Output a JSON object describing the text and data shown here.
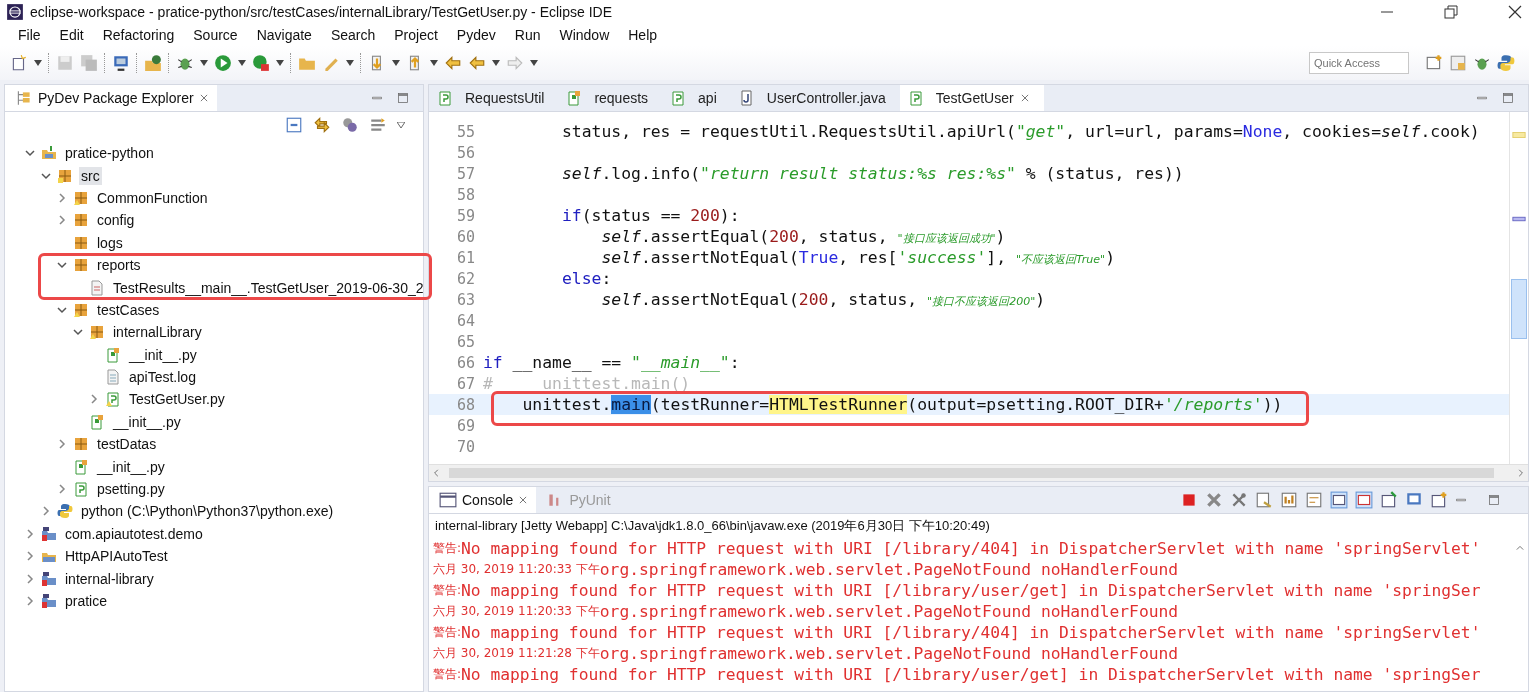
{
  "window": {
    "title": "eclipse-workspace - pratice-python/src/testCases/internalLibrary/TestGetUser.py - Eclipse IDE"
  },
  "menu": [
    "File",
    "Edit",
    "Refactoring",
    "Source",
    "Navigate",
    "Search",
    "Project",
    "Pydev",
    "Run",
    "Window",
    "Help"
  ],
  "quick_access": {
    "placeholder": "Quick Access"
  },
  "explorer": {
    "title": "PyDev Package Explorer",
    "tree": [
      {
        "label": "pratice-python",
        "kind": "project",
        "expanded": true,
        "selected": false,
        "children": [
          {
            "label": "src",
            "kind": "source",
            "expanded": true,
            "selected": true,
            "children": [
              {
                "label": "CommonFunction",
                "kind": "package_warn",
                "expanded": false,
                "selected": false
              },
              {
                "label": "config",
                "kind": "package",
                "expanded": false,
                "selected": false
              },
              {
                "label": "logs",
                "kind": "package",
                "selected": false
              },
              {
                "label": "reports",
                "kind": "package",
                "expanded": true,
                "selected": false,
                "framed": true,
                "children": [
                  {
                    "label": "TestResults__main__.TestGetUser_2019-06-30_2",
                    "kind": "report",
                    "selected": false
                  }
                ]
              },
              {
                "label": "testCases",
                "kind": "package_warn",
                "expanded": true,
                "selected": false,
                "children": [
                  {
                    "label": "internalLibrary",
                    "kind": "package_warn",
                    "expanded": true,
                    "selected": false,
                    "children": [
                      {
                        "label": "__init__.py",
                        "kind": "init",
                        "selected": false
                      },
                      {
                        "label": "apiTest.log",
                        "kind": "text",
                        "selected": false
                      },
                      {
                        "label": "TestGetUser.py",
                        "kind": "module_warn",
                        "expanded": false,
                        "selected": false
                      }
                    ]
                  },
                  {
                    "label": "__init__.py",
                    "kind": "init",
                    "selected": false
                  }
                ]
              },
              {
                "label": "testDatas",
                "kind": "package",
                "expanded": false,
                "selected": false
              },
              {
                "label": "__init__.py",
                "kind": "init",
                "selected": false
              },
              {
                "label": "psetting.py",
                "kind": "module",
                "expanded": false,
                "selected": false
              }
            ]
          },
          {
            "label": "python  (C:\\Python\\Python37\\python.exe)",
            "kind": "interpreter",
            "expanded": false,
            "selected": false
          }
        ]
      },
      {
        "label": "com.apiautotest.demo",
        "kind": "java_project",
        "expanded": false,
        "selected": false
      },
      {
        "label": "HttpAPIAutoTest",
        "kind": "folder_project",
        "expanded": false,
        "selected": false
      },
      {
        "label": "internal-library",
        "kind": "java_project",
        "expanded": false,
        "selected": false
      },
      {
        "label": "pratice",
        "kind": "java_project",
        "expanded": false,
        "selected": false
      }
    ]
  },
  "editor": {
    "tabs": [
      {
        "label": "RequestsUtil",
        "kind": "module",
        "selected": false
      },
      {
        "label": "requests",
        "kind": "init",
        "selected": false
      },
      {
        "label": "api",
        "kind": "module",
        "selected": false
      },
      {
        "label": "UserController.java",
        "kind": "java",
        "selected": false
      },
      {
        "label": "TestGetUser",
        "kind": "module",
        "selected": true
      }
    ],
    "lines": [
      {
        "number": "55",
        "tokens": [
          {
            "kind": "plain",
            "text": "        status, res = requestUtil.RequestsUtil.apiUrl("
          },
          {
            "kind": "string",
            "text": "\"get\""
          },
          {
            "kind": "plain",
            "text": ", url=url, params="
          },
          {
            "kind": "const",
            "text": "None"
          },
          {
            "kind": "plain",
            "text": ", cookies="
          },
          {
            "kind": "self",
            "text": "self"
          },
          {
            "kind": "plain",
            "text": ".cook)"
          }
        ]
      },
      {
        "number": "56"
      },
      {
        "number": "57",
        "tokens": [
          {
            "kind": "self",
            "text": "        self"
          },
          {
            "kind": "plain",
            "text": ".log.info("
          },
          {
            "kind": "string",
            "text": "\"return result status:%s res:%s\""
          },
          {
            "kind": "plain",
            "text": " % (status, res))"
          }
        ]
      },
      {
        "number": "58"
      },
      {
        "number": "59",
        "tokens": [
          {
            "kind": "keyword",
            "text": "        if"
          },
          {
            "kind": "plain",
            "text": "(status == "
          },
          {
            "kind": "number",
            "text": "200"
          },
          {
            "kind": "plain",
            "text": "):"
          }
        ]
      },
      {
        "number": "60",
        "tokens": [
          {
            "kind": "self",
            "text": "            self"
          },
          {
            "kind": "plain",
            "text": ".assertEqual("
          },
          {
            "kind": "number",
            "text": "200"
          },
          {
            "kind": "plain",
            "text": ", status, "
          },
          {
            "kind": "small_string",
            "text": "\"接口应该返回成功\""
          },
          {
            "kind": "plain",
            "text": ")"
          }
        ]
      },
      {
        "number": "61",
        "tokens": [
          {
            "kind": "self",
            "text": "            self"
          },
          {
            "kind": "plain",
            "text": ".assertNotEqual("
          },
          {
            "kind": "const",
            "text": "True"
          },
          {
            "kind": "plain",
            "text": ", res["
          },
          {
            "kind": "string",
            "text": "'success'"
          },
          {
            "kind": "plain",
            "text": "], "
          },
          {
            "kind": "small_string",
            "text": "\"不应该返回True\""
          },
          {
            "kind": "plain",
            "text": ")"
          }
        ]
      },
      {
        "number": "62",
        "tokens": [
          {
            "kind": "keyword",
            "text": "        else"
          },
          {
            "kind": "plain",
            "text": ":"
          }
        ]
      },
      {
        "number": "63",
        "tokens": [
          {
            "kind": "self",
            "text": "            self"
          },
          {
            "kind": "plain",
            "text": ".assertNotEqual("
          },
          {
            "kind": "number",
            "text": "200"
          },
          {
            "kind": "plain",
            "text": ", status, "
          },
          {
            "kind": "small_string",
            "text": "\"接口不应该返回200\""
          },
          {
            "kind": "plain",
            "text": ")"
          }
        ]
      },
      {
        "number": "64"
      },
      {
        "number": "65"
      },
      {
        "number": "66",
        "tokens": [
          {
            "kind": "keyword",
            "text": "if"
          },
          {
            "kind": "plain",
            "text": " __name__ == "
          },
          {
            "kind": "string",
            "text": "\"__main__\""
          },
          {
            "kind": "plain",
            "text": ":"
          }
        ]
      },
      {
        "number": "67",
        "tokens": [
          {
            "kind": "comment",
            "text": "#     unittest.main()"
          }
        ]
      },
      {
        "number": "68",
        "current": true,
        "framed": true,
        "tokens": [
          {
            "kind": "plain",
            "text": "    unittest."
          },
          {
            "kind": "selection",
            "text": "main"
          },
          {
            "kind": "plain",
            "text": "(testRunner="
          },
          {
            "kind": "mark",
            "text": "HTMLTestRunner"
          },
          {
            "kind": "plain",
            "text": "(output=psetting.ROOT_DIR+"
          },
          {
            "kind": "string",
            "text": "'/reports'"
          },
          {
            "kind": "plain",
            "text": "))"
          }
        ]
      },
      {
        "number": "69"
      },
      {
        "number": "70"
      }
    ]
  },
  "console": {
    "tabs": [
      {
        "label": "Console",
        "selected": true
      },
      {
        "label": "PyUnit",
        "selected": false
      }
    ],
    "description": "internal-library [Jetty Webapp] C:\\Java\\jdk1.8.0_66\\bin\\javaw.exe (2019年6月30日 下午10:20:49)",
    "lines": [
      {
        "prefix": "警告:",
        "message": "No mapping found for HTTP request with URI [/library/404] in DispatcherServlet with name 'springServlet'"
      },
      {
        "prefix": "六月 30, 2019 11:20:33 下午",
        "message": "org.springframework.web.servlet.PageNotFound noHandlerFound"
      },
      {
        "prefix": "警告:",
        "message": "No mapping found for HTTP request with URI [/library/user/get] in DispatcherServlet with name 'springSer"
      },
      {
        "prefix": "六月 30, 2019 11:20:33 下午",
        "message": "org.springframework.web.servlet.PageNotFound noHandlerFound"
      },
      {
        "prefix": "警告:",
        "message": "No mapping found for HTTP request with URI [/library/404] in DispatcherServlet with name 'springServlet'"
      },
      {
        "prefix": "六月 30, 2019 11:21:28 下午",
        "message": "org.springframework.web.servlet.PageNotFound noHandlerFound"
      },
      {
        "prefix": "警告:",
        "message": "No mapping found for HTTP request with URI [/library/user/get] in DispatcherServlet with name 'springSer"
      }
    ]
  }
}
